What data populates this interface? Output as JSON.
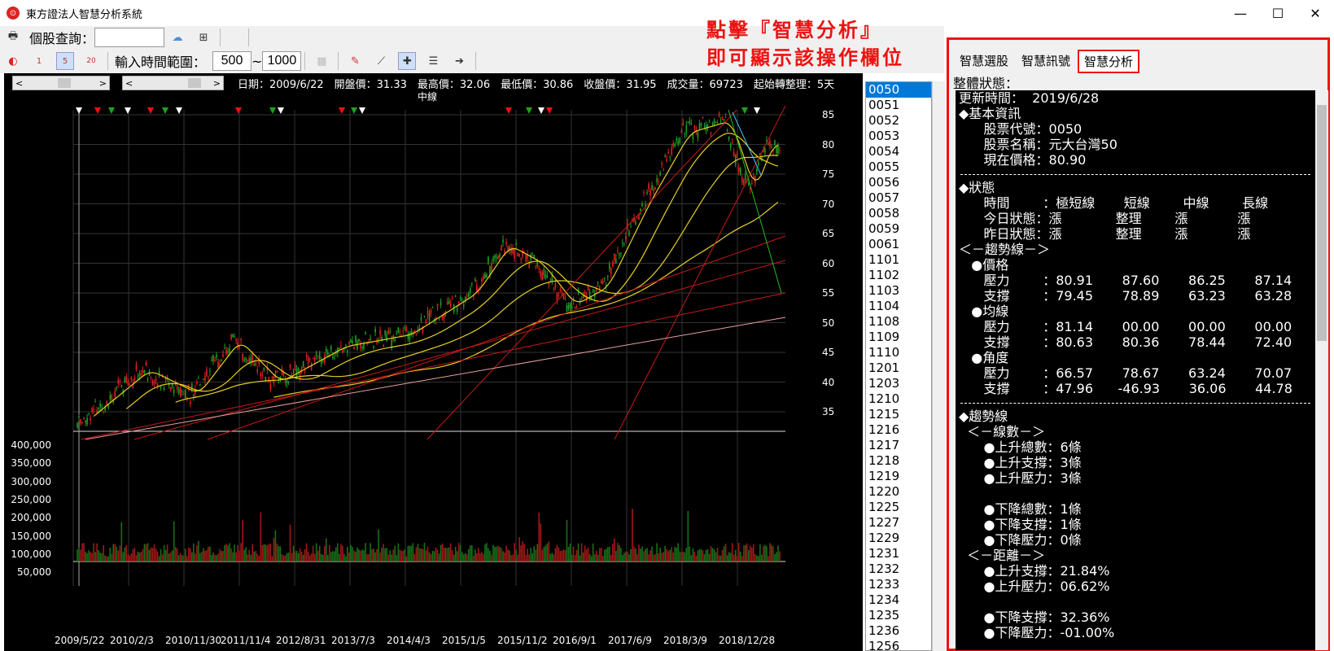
{
  "app": {
    "title": "東方證法人智慧分析系統",
    "logo": "⊙"
  },
  "window": {
    "min": "—",
    "max": "☐",
    "close": "✕"
  },
  "toolbar": {
    "query_label": "個股查詢：",
    "query_value": "",
    "range_label": "輸入時間範圍：",
    "range_from": "500",
    "range_sep": "~",
    "range_to": "1000"
  },
  "chart": {
    "info": "日期：2009/6/22　開盤價：31.33　最高價：32.06　最低價：30.86　收盤價：31.95　成交量：69723　起始轉整理：5天",
    "mid_label": "中線",
    "y_ticks": [
      "85",
      "80",
      "75",
      "70",
      "65",
      "60",
      "55",
      "50",
      "45",
      "40",
      "35"
    ],
    "vol_ticks": [
      "400,000",
      "350,000",
      "300,000",
      "250,000",
      "200,000",
      "150,000",
      "100,000",
      "50,000"
    ],
    "x_ticks": [
      "2009/5/22",
      "2010/2/3",
      "2010/11/30",
      "2011/11/4",
      "2012/8/31",
      "2013/7/3",
      "2014/4/3",
      "2015/1/5",
      "2015/11/2",
      "2016/9/1",
      "2017/6/9",
      "2018/3/9",
      "2018/12/28"
    ]
  },
  "stock_list": [
    "0050",
    "0051",
    "0052",
    "0053",
    "0054",
    "0055",
    "0056",
    "0057",
    "0058",
    "0059",
    "0061",
    "1101",
    "1102",
    "1103",
    "1104",
    "1108",
    "1109",
    "1110",
    "1201",
    "1203",
    "1210",
    "1215",
    "1216",
    "1217",
    "1218",
    "1219",
    "1220",
    "1225",
    "1227",
    "1229",
    "1231",
    "1232",
    "1233",
    "1234",
    "1235",
    "1236",
    "1256"
  ],
  "annotation": {
    "line1": "點擊『智慧分析』",
    "line2": "即可顯示該操作欄位"
  },
  "panel": {
    "tabs": [
      "智慧選股",
      "智慧訊號",
      "智慧分析"
    ],
    "state_label": "整體狀態：",
    "lines": [
      "更新時間：  2019/6/28",
      "◆基本資訊",
      "      股票代號：0050",
      "      股票名稱：元大台灣50",
      "      現在價格：80.90",
      "---",
      "◆狀態",
      "      時間        ：極短線       短線        中線        長線",
      "      今日狀態：漲             整理        漲            漲",
      "      昨日狀態：漲             整理        漲            漲",
      "＜－趨勢線－＞",
      "   ●價格",
      "      壓力        ：80.91       87.60       86.25       87.14",
      "      支撐        ：79.45       78.89       63.23       63.28",
      "   ●均線",
      "      壓力        ：81.14       00.00       00.00       00.00",
      "      支撐        ：80.63       80.36       78.44       72.40",
      "   ●角度",
      "      壓力        ：66.57       78.67       63.24       70.07",
      "      支撐        ：47.96      -46.93       36.06       44.78",
      "---",
      "◆趨勢線",
      "  ＜－線數－＞",
      "      ●上升總數：6條",
      "      ●上升支撐：3條",
      "      ●上升壓力：3條",
      "",
      "      ●下降總數：1條",
      "      ●下降支撐：1條",
      "      ●下降壓力：0條",
      "  ＜－距離－＞",
      "      ●上升支撐：21.84%",
      "      ●上升壓力：06.62%",
      "",
      "      ●下降支撐：32.36%",
      "      ●下降壓力：-01.00%"
    ]
  },
  "colors": {
    "accent": "#e11",
    "up": "#e02020",
    "down": "#20a020",
    "ma": "#e6d020"
  }
}
